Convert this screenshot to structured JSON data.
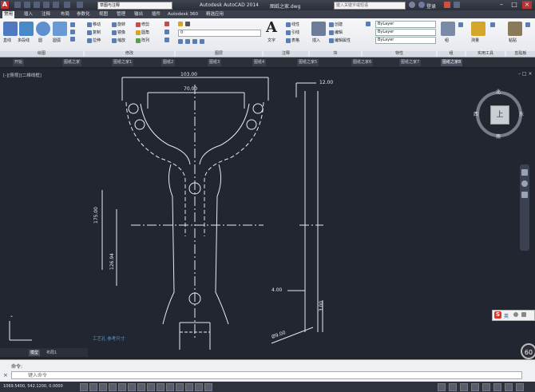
{
  "titlebar": {
    "workspace": "草图与注释",
    "app_title": "Autodesk AutoCAD 2014",
    "file_name": "图纸之家.dwg",
    "search_placeholder": "键入关键字或短语",
    "user": "登录"
  },
  "ribbon_tabs": [
    "常用",
    "插入",
    "注释",
    "布局",
    "参数化",
    "视图",
    "管理",
    "输出",
    "插件",
    "Autodesk 360",
    "精选应用"
  ],
  "ribbon": {
    "draw_tools": [
      "直线",
      "多段线",
      "圆",
      "圆弧"
    ],
    "modify_items": [
      "移动",
      "旋转",
      "修剪",
      "复制",
      "镜像",
      "圆角",
      "拉伸",
      "缩放",
      "阵列"
    ],
    "text_tool": "文字",
    "annotation_items": [
      "线性",
      "引线",
      "表格"
    ],
    "layer_dropdown": "0",
    "insert_tool": "插入",
    "block_items": [
      "创建",
      "编辑",
      "编辑属性"
    ],
    "properties_items": [
      "ByLayer",
      "ByLayer",
      "ByLayer"
    ],
    "group_tool": "组",
    "utility_tool": "测量",
    "clipboard_tool": "粘贴",
    "panel_labels": [
      "绘图",
      "修改",
      "图层",
      "注释",
      "块",
      "特性",
      "组",
      "实用工具",
      "剪贴板"
    ]
  },
  "doc_tabs": [
    "开始",
    "图纸之家",
    "图纸之家1",
    "图纸2",
    "图纸3",
    "图纸4",
    "图纸之家5",
    "图纸之家6",
    "图纸之家7",
    "图纸之家8"
  ],
  "viewport_label": "[-][俯视][二维线框]",
  "dimensions": {
    "top_outer": "103.00",
    "top_inner": "70.00",
    "right_top": "12.00",
    "left_vertical": "175.00",
    "left_inner": "126.94",
    "right_mid": "4.00",
    "right_bottom": "3.00",
    "diameter_note": "Ø9.00",
    "bottom_note": "工艺孔 参考尺寸"
  },
  "viewcube": {
    "north": "北",
    "south": "南",
    "east": "东",
    "west": "西",
    "face": "上"
  },
  "layout_tabs": [
    "模型",
    "布局1"
  ],
  "command": {
    "history": "命令:",
    "prompt": "键入命令"
  },
  "status": {
    "coords": "1069.5400, 542.1200, 0.0000",
    "ime": "英"
  },
  "zoom_badge": "60"
}
